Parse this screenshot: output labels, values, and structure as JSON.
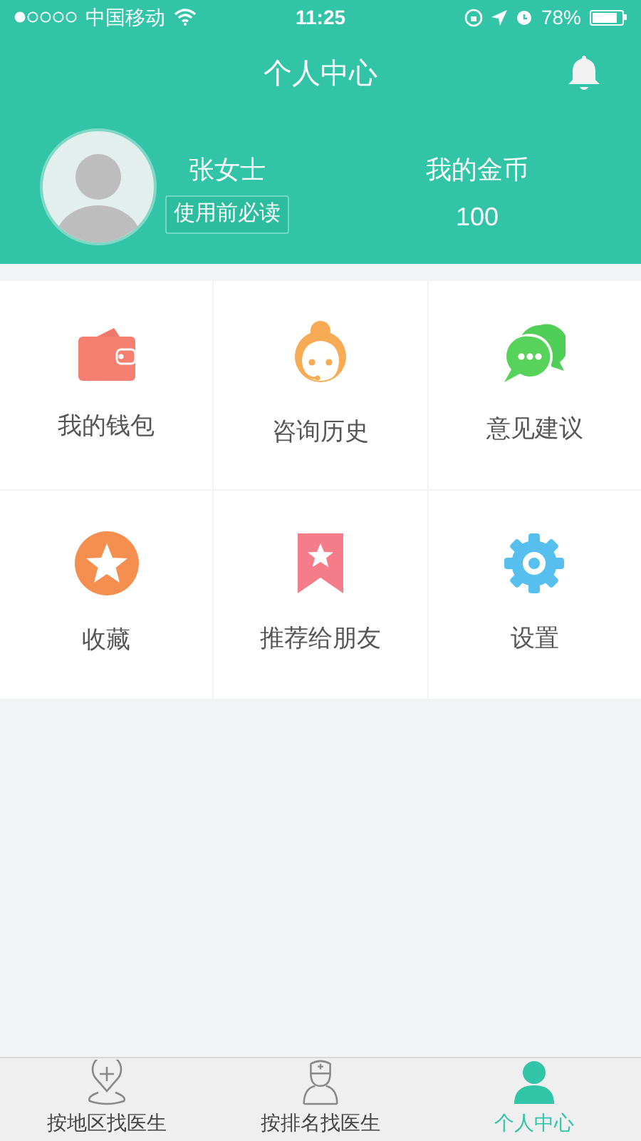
{
  "status_bar": {
    "carrier": "中国移动",
    "time": "11:25",
    "battery": "78%"
  },
  "header": {
    "title": "个人中心"
  },
  "profile": {
    "name": "张女士",
    "badge": "使用前必读",
    "coins_label": "我的金币",
    "coins": "100"
  },
  "menu": [
    {
      "label": "我的钱包",
      "kind": "wallet"
    },
    {
      "label": "咨询历史",
      "kind": "agent"
    },
    {
      "label": "意见建议",
      "kind": "chat"
    },
    {
      "label": "收藏",
      "kind": "favorite"
    },
    {
      "label": "推荐给朋友",
      "kind": "bookmark"
    },
    {
      "label": "设置",
      "kind": "settings"
    }
  ],
  "tab_bar": [
    {
      "label": "按地区找医生",
      "kind": "location",
      "selected": false
    },
    {
      "label": "按排名找医生",
      "kind": "doctor",
      "selected": false
    },
    {
      "label": "个人中心",
      "kind": "person",
      "selected": true
    }
  ]
}
